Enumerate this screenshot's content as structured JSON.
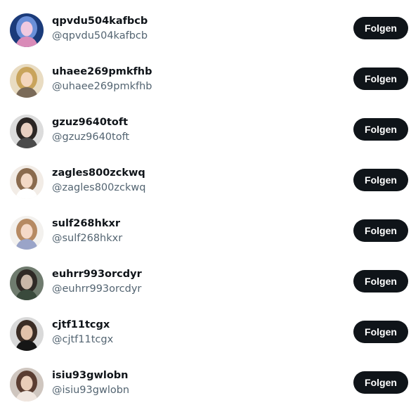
{
  "follow_suggestions": [
    {
      "display_name": "qpvdu504kafbcb",
      "handle": "@qpvdu504kafbcb",
      "follow_label": "Folgen",
      "avatar_colors": [
        "#1b3b7a",
        "#6a8fd8",
        "#f0c9e0",
        "#d98bb8"
      ]
    },
    {
      "display_name": "uhaee269pmkfhb",
      "handle": "@uhaee269pmkfhb",
      "follow_label": "Folgen",
      "avatar_colors": [
        "#e9dcc2",
        "#c9a45c",
        "#f4d6bd",
        "#7a6a58"
      ]
    },
    {
      "display_name": "gzuz9640toft",
      "handle": "@gzuz9640toft",
      "follow_label": "Folgen",
      "avatar_colors": [
        "#dcdcdc",
        "#2b2624",
        "#e8cfc1",
        "#4a4a4a"
      ]
    },
    {
      "display_name": "zagles800zckwq",
      "handle": "@zagles800zckwq",
      "follow_label": "Folgen",
      "avatar_colors": [
        "#f2ece6",
        "#8a6b4e",
        "#f3d9c6",
        "#ffffff"
      ]
    },
    {
      "display_name": "sulf268hkxr",
      "handle": "@sulf268hkxr",
      "follow_label": "Folgen",
      "avatar_colors": [
        "#f3f1ee",
        "#b68a63",
        "#f5d9c8",
        "#9aa4c8"
      ]
    },
    {
      "display_name": "euhrr993orcdyr",
      "handle": "@euhrr993orcdyr",
      "follow_label": "Folgen",
      "avatar_colors": [
        "#6f7b6e",
        "#2f2a26",
        "#c8b7a8",
        "#3a4a3c"
      ]
    },
    {
      "display_name": "cjtf11tcgx",
      "handle": "@cjtf11tcgx",
      "follow_label": "Folgen",
      "avatar_colors": [
        "#d9d9d9",
        "#3a2c24",
        "#e2c2aa",
        "#161616"
      ]
    },
    {
      "display_name": "isiu93gwlobn",
      "handle": "@isiu93gwlobn",
      "follow_label": "Folgen",
      "avatar_colors": [
        "#cfc6bf",
        "#5a3d31",
        "#e9cdb8",
        "#f0e6df"
      ]
    }
  ]
}
